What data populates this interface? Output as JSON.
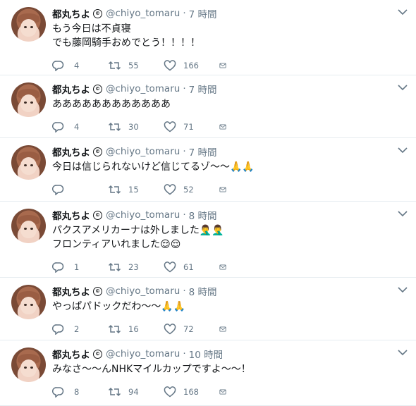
{
  "tweets": [
    {
      "name": "都丸ちよ",
      "handle": "@chiyo_tomaru",
      "time": "7 時間",
      "lines": [
        "もう今日は不貞寝",
        "でも藤岡騎手おめでとう！！！！"
      ],
      "replies": "4",
      "retweets": "55",
      "likes": "166"
    },
    {
      "name": "都丸ちよ",
      "handle": "@chiyo_tomaru",
      "time": "7 時間",
      "lines": [
        "ああああああああああああ"
      ],
      "replies": "4",
      "retweets": "30",
      "likes": "71"
    },
    {
      "name": "都丸ちよ",
      "handle": "@chiyo_tomaru",
      "time": "7 時間",
      "lines": [
        "今日は信じられないけど信じてるゾ〜〜🙏🙏"
      ],
      "replies": "",
      "retweets": "15",
      "likes": "52"
    },
    {
      "name": "都丸ちよ",
      "handle": "@chiyo_tomaru",
      "time": "8 時間",
      "lines": [
        "パクスアメリカーナは外しました🤦‍♂️🤦‍♂️",
        "フロンティアいれました😌😌"
      ],
      "replies": "1",
      "retweets": "23",
      "likes": "61"
    },
    {
      "name": "都丸ちよ",
      "handle": "@chiyo_tomaru",
      "time": "8 時間",
      "lines": [
        "やっぱパドックだわ〜〜🙏🙏"
      ],
      "replies": "2",
      "retweets": "16",
      "likes": "72"
    },
    {
      "name": "都丸ちよ",
      "handle": "@chiyo_tomaru",
      "time": "10 時間",
      "lines": [
        "みなさ〜〜んNHKマイルカップですよ〜〜！"
      ],
      "replies": "8",
      "retweets": "94",
      "likes": "168"
    }
  ],
  "icons": {
    "reply": "reply-icon",
    "retweet": "retweet-icon",
    "like": "heart-icon",
    "message": "direct-message-icon",
    "menu": "chevron-down-icon",
    "verified": "verified-badge-icon"
  },
  "colors": {
    "icon": "#657786",
    "text": "#14171a",
    "border": "#e6ecf0"
  }
}
